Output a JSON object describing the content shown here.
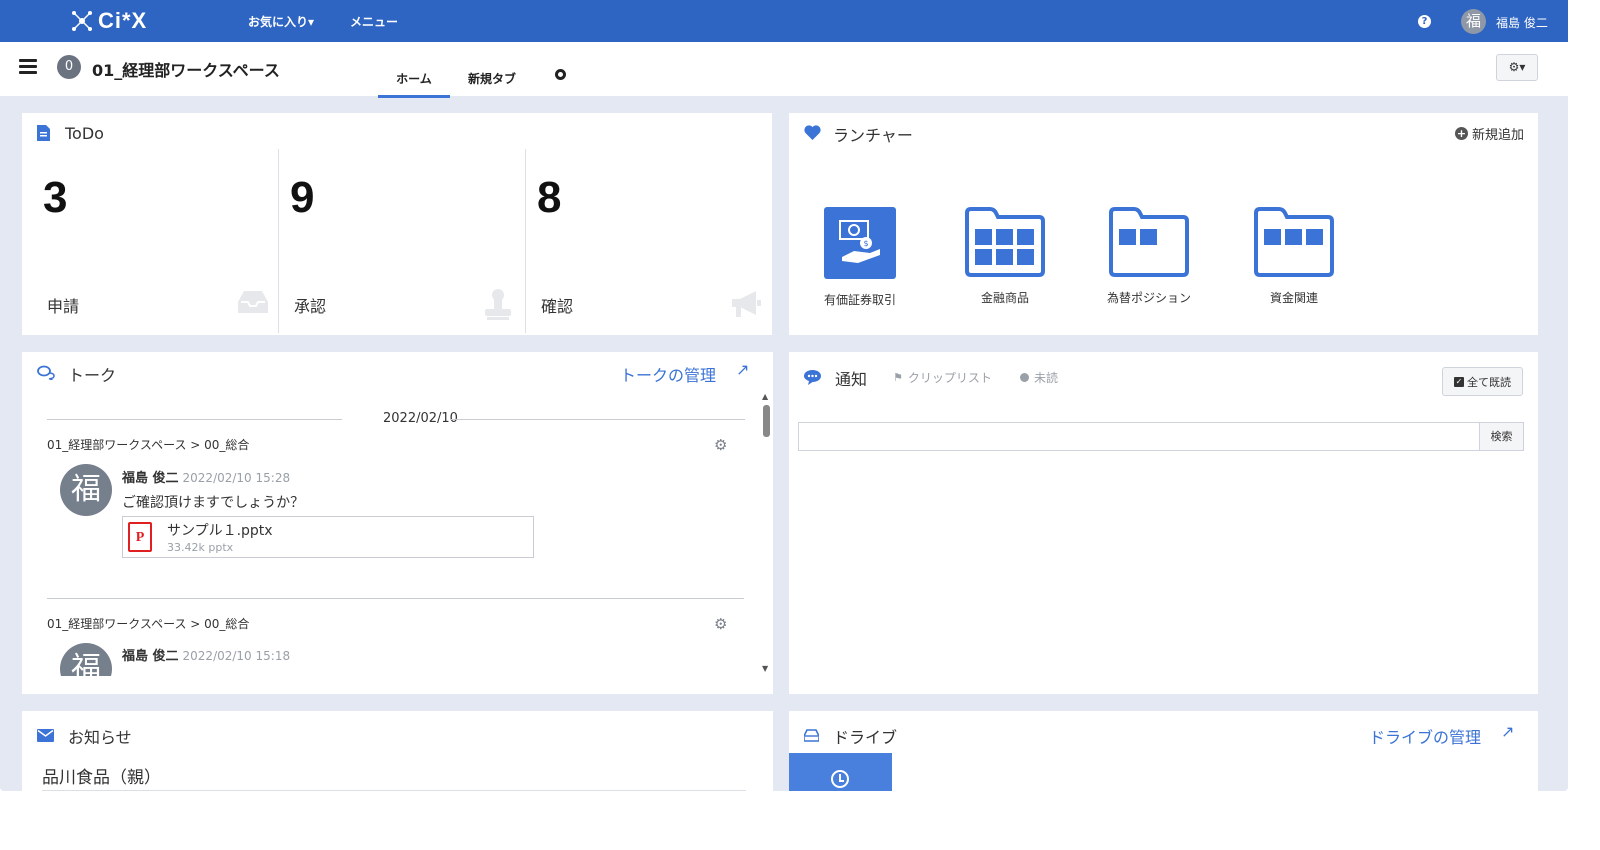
{
  "colors": {
    "brand": "#2e64c2",
    "accent": "#3b73d6",
    "app_bg": "#e3e8f2"
  },
  "topnav": {
    "logo": "Ci*X",
    "favorites": "お気に入り▾",
    "menu": "メニュー",
    "help": "?",
    "avatar_char": "福",
    "user_name": "福島 俊二"
  },
  "subheader": {
    "workspace_badge": "0",
    "workspace_title": "01_経理部ワークスペース",
    "tabs": [
      {
        "label": "ホーム",
        "active": true
      },
      {
        "label": "新規タブ",
        "active": false
      }
    ],
    "settings": "⚙▾"
  },
  "todo": {
    "title": "ToDo",
    "items": [
      {
        "count": "3",
        "label": "申請",
        "icon": "inbox-icon"
      },
      {
        "count": "9",
        "label": "承認",
        "icon": "stamp-icon"
      },
      {
        "count": "8",
        "label": "確認",
        "icon": "megaphone-icon"
      }
    ]
  },
  "launcher": {
    "title": "ランチャー",
    "add_new": "新規追加",
    "items": [
      {
        "label": "有価証券取引",
        "icon": "securities-icon"
      },
      {
        "label": "金融商品",
        "icon": "folder-icon"
      },
      {
        "label": "為替ポジション",
        "icon": "folder-icon"
      },
      {
        "label": "資金関連",
        "icon": "folder-icon"
      }
    ]
  },
  "talk": {
    "title": "トーク",
    "manage_link": "トークの管理",
    "external": "↗",
    "date": "2022/02/10",
    "messages": [
      {
        "path": "01_経理部ワークスペース > 00_総合",
        "avatar": "福",
        "name": "福島 俊二",
        "time": "2022/02/10 15:28",
        "text": "ご確認頂けますでしょうか？",
        "attachment": {
          "name": "サンプル１.pptx",
          "meta": "33.42k pptx",
          "type": "P"
        }
      },
      {
        "path": "01_経理部ワークスペース > 00_総合",
        "avatar": "福",
        "name": "福島 俊二",
        "time": "2022/02/10 15:18"
      }
    ]
  },
  "notice": {
    "title": "通知",
    "tab_clip": "クリップリスト",
    "tab_unread": "未読",
    "mark_all_read": "全て既読",
    "search_placeholder": "",
    "search_button": "検索"
  },
  "news": {
    "title": "お知らせ",
    "items": [
      "品川食品（親）"
    ]
  },
  "drive": {
    "title": "ドライブ",
    "manage_link": "ドライブの管理",
    "external": "↗"
  }
}
